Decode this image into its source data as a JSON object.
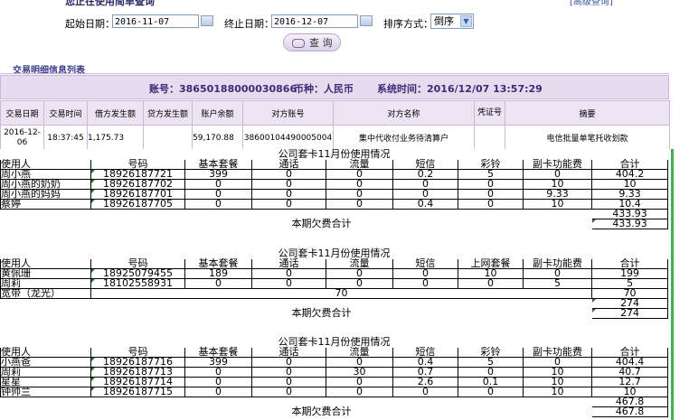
{
  "top": {
    "cut_title": "您正在使用简单查询",
    "cut_right": "[高级查询]"
  },
  "filters": {
    "start_label": "起始日期：",
    "start_value": "2016-11-07",
    "end_label": "终止日期：",
    "end_value": "2016-12-07",
    "sort_label": "排序方式：",
    "sort_value": "倒序",
    "query_label": "查 询"
  },
  "section_title": "交易明细信息列表",
  "account_bar": {
    "account": "账号：38650188000030866",
    "currency": "币种：人民币",
    "systime": "系统时间：2016/12/07 13:57:29"
  },
  "txn_table": {
    "headers": [
      "交易日期",
      "交易时间",
      "借方发生额",
      "贷方发生额",
      "账户余额",
      "对方账号",
      "对方名称",
      "凭证号",
      "摘要"
    ],
    "rows": [
      [
        "2016-12-06",
        "18:37:45",
        "1,175.73",
        "",
        "59,170.88",
        "38600104490005004",
        "集中代收付业务待清算户",
        "",
        "电信批量单笔托收划款"
      ]
    ]
  },
  "icons": {
    "calendar": "calendar-icon",
    "dropdown": "chevron-down-icon",
    "search": "search-icon"
  },
  "colors": {
    "accent_bar": "#e6dcef",
    "green_edge": "#39b54a"
  },
  "sheet": {
    "groups": [
      {
        "title": "公司套卡11月份使用情况",
        "headers": [
          "使用人",
          "号码",
          "基本套餐",
          "通话",
          "流量",
          "短信",
          "彩铃",
          "副卡功能费",
          "合计"
        ],
        "rows": [
          [
            "周小燕",
            "18926187721",
            "399",
            "0",
            "0",
            "0.2",
            "5",
            "0",
            "404.2"
          ],
          [
            "周小燕的奶奶",
            "18926187702",
            "0",
            "0",
            "0",
            "0",
            "0",
            "10",
            "10"
          ],
          [
            "周小燕的妈妈",
            "18926187701",
            "0",
            "0",
            "0",
            "0",
            "0",
            "9.33",
            "9.33"
          ],
          [
            "蔡婷",
            "18926187705",
            "0",
            "0",
            "0",
            "0.4",
            "0",
            "10",
            "10.4"
          ]
        ],
        "subtotal": "433.93",
        "total_label": "本期欠费合计",
        "total_value": "433.93"
      },
      {
        "title": "公司套卡11月份使用情况",
        "headers": [
          "使用人",
          "号码",
          "基本套餐",
          "通话",
          "流量",
          "短信",
          "上网套餐",
          "副卡功能费",
          "合计"
        ],
        "rows": [
          [
            "黄佩珊",
            "18925079455",
            "189",
            "0",
            "0",
            "0",
            "10",
            "0",
            "199"
          ],
          [
            "周莉",
            "18102558931",
            "0",
            "0",
            "0",
            "0",
            "0",
            "5",
            "5"
          ]
        ],
        "broadband_label": "宽带（龙光）",
        "broadband_mid": "70",
        "broadband_total": "70",
        "subtotal": "274",
        "total_label": "本期欠费合计",
        "total_value": "274"
      },
      {
        "title": "公司套卡11月份使用情况",
        "headers": [
          "使用人",
          "号码",
          "基本套餐",
          "通话",
          "流量",
          "短信",
          "彩铃",
          "副卡功能费",
          "合计"
        ],
        "rows": [
          [
            "小燕爸",
            "18926187716",
            "399",
            "0",
            "0",
            "0.4",
            "5",
            "0",
            "404.4"
          ],
          [
            "周莉",
            "18926187713",
            "0",
            "0",
            "30",
            "0.7",
            "0",
            "10",
            "40.7"
          ],
          [
            "星星",
            "18926187714",
            "0",
            "0",
            "0",
            "2.6",
            "0.1",
            "10",
            "12.7"
          ],
          [
            "钟帅兰",
            "18926187715",
            "0",
            "0",
            "0",
            "0",
            "0",
            "10",
            "10"
          ]
        ],
        "subtotal": "467.8",
        "total_label": "本期欠费合计",
        "total_value": "467.8"
      }
    ]
  }
}
